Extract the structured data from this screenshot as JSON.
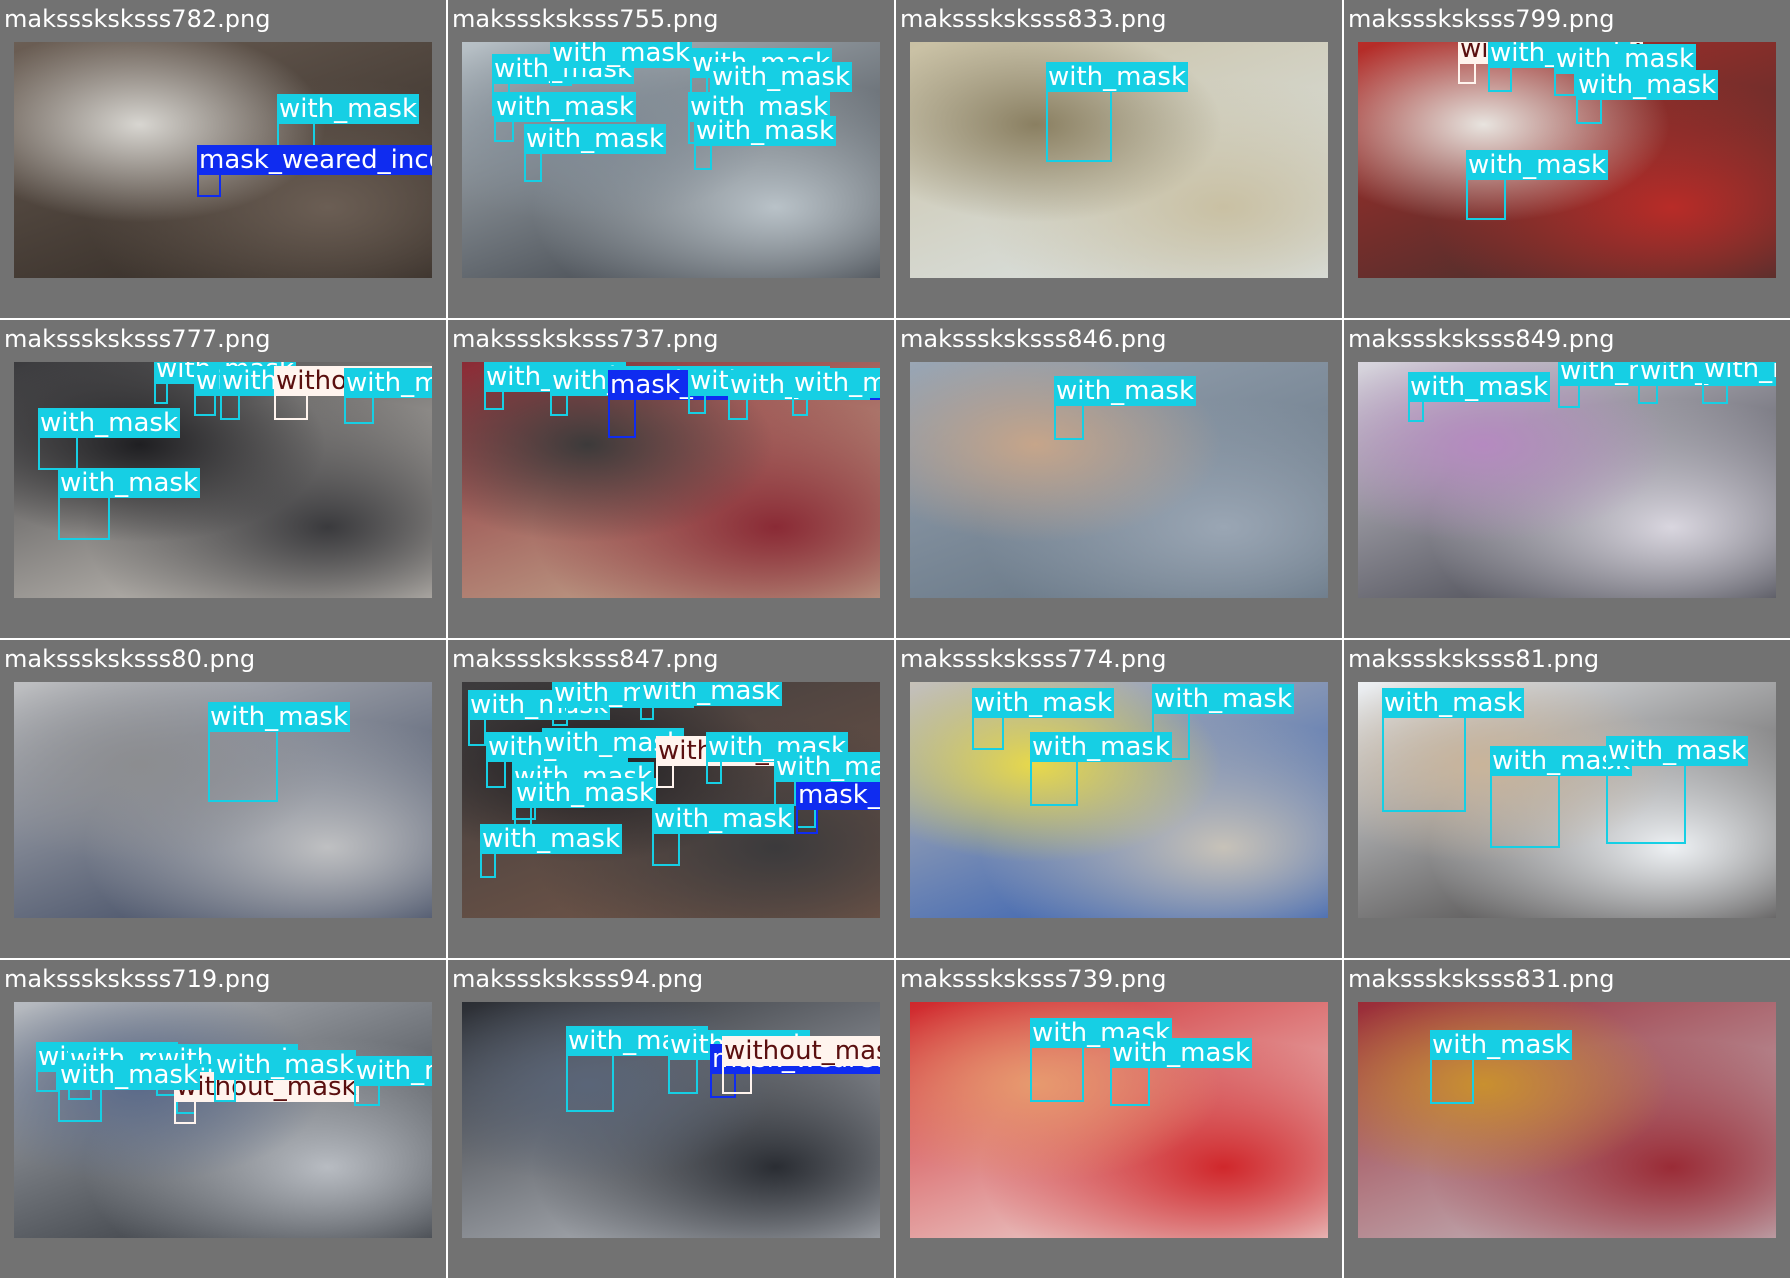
{
  "classes": {
    "with_mask": {
      "label": "with_mask",
      "color": "#16cfe4"
    },
    "without_mask": {
      "label": "without_mask",
      "color": "#fff4ee"
    },
    "mask_weared_incorrect": {
      "label": "mask_weared_incorrect",
      "color": "#0f2cf0"
    }
  },
  "cells": [
    {
      "filename": "maksssksksss782.png",
      "scene_colors": [
        "#6b5e54",
        "#2c2520",
        "#d8d6d1"
      ],
      "detections": [
        {
          "cls": "with_mask"
        },
        {
          "cls": "mask_weared_incorrect"
        }
      ]
    },
    {
      "filename": "maksssksksss755.png",
      "scene_colors": [
        "#b9c2c8",
        "#2b2f36",
        "#7f8a95"
      ],
      "detections": [
        {
          "cls": "with_mask"
        },
        {
          "cls": "with_mask"
        },
        {
          "cls": "with_mask"
        },
        {
          "cls": "with_mask"
        },
        {
          "cls": "with_mask"
        },
        {
          "cls": "with_mask"
        },
        {
          "cls": "with_mask"
        },
        {
          "cls": "with_mask"
        }
      ]
    },
    {
      "filename": "maksssksksss833.png",
      "scene_colors": [
        "#c9c0a3",
        "#dde6ea",
        "#8a7f61"
      ],
      "detections": [
        {
          "cls": "with_mask"
        }
      ]
    },
    {
      "filename": "maksssksksss799.png",
      "scene_colors": [
        "#b82c28",
        "#34302e",
        "#e8e4df"
      ],
      "detections": [
        {
          "cls": "without_mask"
        },
        {
          "cls": "with_mask"
        },
        {
          "cls": "with_mask"
        },
        {
          "cls": "with_mask"
        },
        {
          "cls": "with_mask"
        },
        {
          "cls": "with_mask"
        }
      ]
    },
    {
      "filename": "maksssksksss777.png",
      "scene_colors": [
        "#3a3a3d",
        "#d8d3cb",
        "#1f1f22"
      ],
      "detections": [
        {
          "cls": "with_mask"
        },
        {
          "cls": "with_mask"
        },
        {
          "cls": "with_mask"
        },
        {
          "cls": "without_mask"
        },
        {
          "cls": "with_mask"
        },
        {
          "cls": "with_mask"
        },
        {
          "cls": "with_mask"
        },
        {
          "cls": "with_mask"
        }
      ]
    },
    {
      "filename": "maksssksksss737.png",
      "scene_colors": [
        "#8a2a35",
        "#c9b89a",
        "#3c3a3a"
      ],
      "detections": [
        {
          "cls": "with_mask"
        },
        {
          "cls": "with_mask"
        },
        {
          "cls": "mask_weared_incorrect"
        },
        {
          "cls": "with_mask"
        },
        {
          "cls": "with_mask"
        },
        {
          "cls": "with_mask"
        }
      ]
    },
    {
      "filename": "maksssksksss846.png",
      "scene_colors": [
        "#9aa6b4",
        "#5d6d7c",
        "#c6a58a"
      ],
      "detections": [
        {
          "cls": "with_mask"
        }
      ]
    },
    {
      "filename": "maksssksksss849.png",
      "scene_colors": [
        "#d9d6df",
        "#2b2d36",
        "#b58ac0"
      ],
      "detections": [
        {
          "cls": "with_mask"
        },
        {
          "cls": "with_mask"
        },
        {
          "cls": "with_mask"
        },
        {
          "cls": "with_mask"
        }
      ]
    },
    {
      "filename": "maksssksksss80.png",
      "scene_colors": [
        "#bfc0c2",
        "#2a3652",
        "#8c8d90"
      ],
      "detections": [
        {
          "cls": "with_mask"
        }
      ]
    },
    {
      "filename": "maksssksksss847.png",
      "scene_colors": [
        "#3b3a3c",
        "#7a5a4a",
        "#1e1e22"
      ],
      "detections": [
        {
          "cls": "with_mask"
        },
        {
          "cls": "with_mask"
        },
        {
          "cls": "with_mask"
        },
        {
          "cls": "with_mask"
        },
        {
          "cls": "with_mask"
        },
        {
          "cls": "without_mask"
        },
        {
          "cls": "with_mask"
        },
        {
          "cls": "with_mask"
        },
        {
          "cls": "with_mask"
        },
        {
          "cls": "mask_weared_incorrect"
        },
        {
          "cls": "with_mask"
        },
        {
          "cls": "with_mask"
        },
        {
          "cls": "with_mask"
        },
        {
          "cls": "with_mask"
        }
      ]
    },
    {
      "filename": "maksssksksss774.png",
      "scene_colors": [
        "#c7c2b8",
        "#1d4fb0",
        "#e8d94a"
      ],
      "detections": [
        {
          "cls": "with_mask"
        },
        {
          "cls": "with_mask"
        },
        {
          "cls": "with_mask"
        }
      ]
    },
    {
      "filename": "maksssksksss81.png",
      "scene_colors": [
        "#eef1f4",
        "#2f2c2b",
        "#c9b49a"
      ],
      "detections": [
        {
          "cls": "with_mask"
        },
        {
          "cls": "with_mask"
        },
        {
          "cls": "with_mask"
        }
      ]
    },
    {
      "filename": "maksssksksss719.png",
      "scene_colors": [
        "#b8bcc2",
        "#1f2329",
        "#5a6a8a"
      ],
      "detections": [
        {
          "cls": "with_mask"
        },
        {
          "cls": "with_mask"
        },
        {
          "cls": "with_mask"
        },
        {
          "cls": "with_mask"
        },
        {
          "cls": "without_mask"
        },
        {
          "cls": "with_mask"
        },
        {
          "cls": "with_mask"
        },
        {
          "cls": "with_mask"
        }
      ]
    },
    {
      "filename": "maksssksksss94.png",
      "scene_colors": [
        "#2a2d33",
        "#c7cbd1",
        "#5a6578"
      ],
      "detections": [
        {
          "cls": "with_mask"
        },
        {
          "cls": "with_mask"
        },
        {
          "cls": "mask_weared_incorrect"
        },
        {
          "cls": "without_mask"
        }
      ]
    },
    {
      "filename": "maksssksksss739.png",
      "scene_colors": [
        "#d0272b",
        "#f0efec",
        "#e79a6e"
      ],
      "detections": [
        {
          "cls": "with_mask"
        },
        {
          "cls": "with_mask"
        }
      ]
    },
    {
      "filename": "maksssksksss831.png",
      "scene_colors": [
        "#9a2b36",
        "#c9cbd0",
        "#c9902f"
      ],
      "detections": [
        {
          "cls": "with_mask"
        }
      ]
    }
  ]
}
